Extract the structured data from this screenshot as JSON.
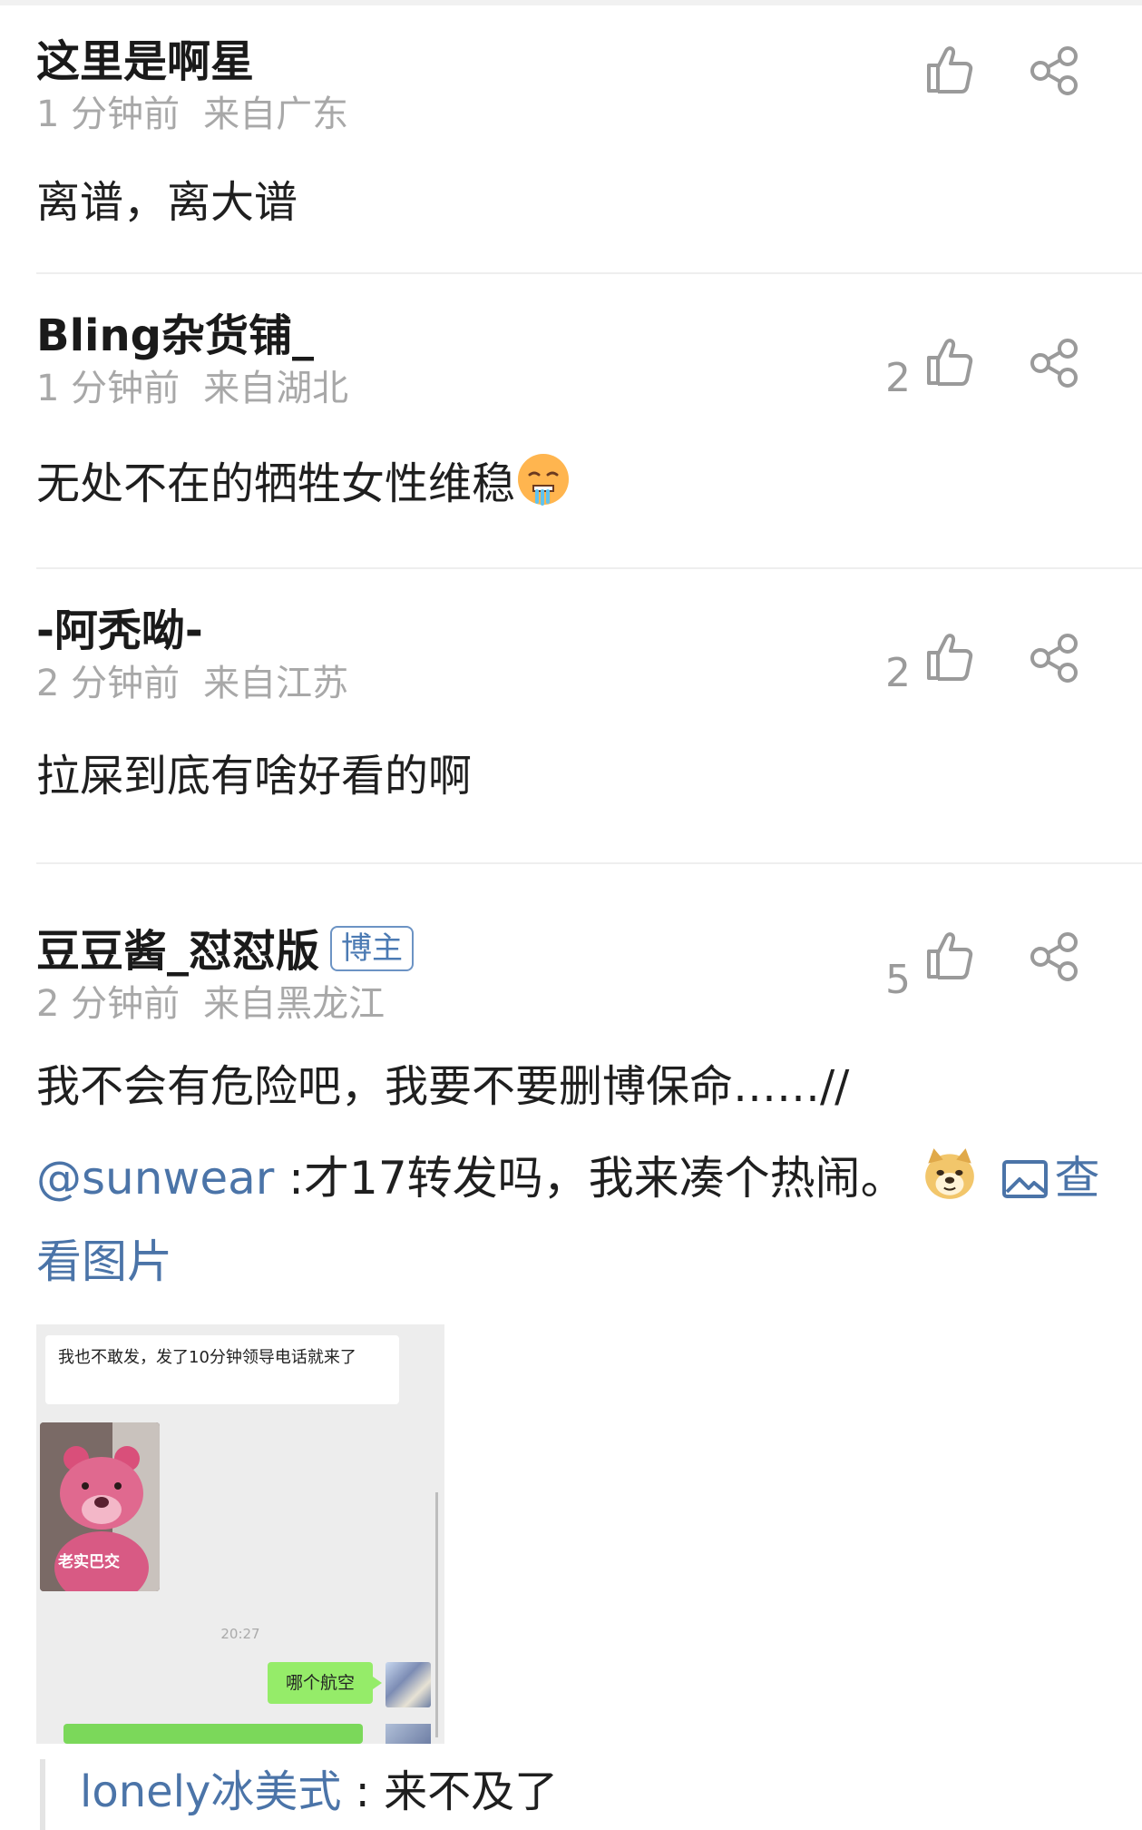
{
  "comments": [
    {
      "username": "这里是啊星",
      "time": "1 分钟前",
      "location": "来自广东",
      "text": "离谱，离大谱",
      "likes": ""
    },
    {
      "username": "Bling杂货铺_",
      "time": "1 分钟前",
      "location": "来自湖北",
      "text": "无处不在的牺牲女性维稳",
      "emoji": "hot-face-emoji",
      "likes": "2"
    },
    {
      "username": "-阿秃呦-",
      "time": "2 分钟前",
      "location": "来自江苏",
      "text": "拉屎到底有啥好看的啊",
      "likes": "2"
    },
    {
      "username": "豆豆酱_怼怼版",
      "badge": "博主",
      "time": "2 分钟前",
      "location": "来自黑龙江",
      "text": "我不会有危险吧，我要不要删博保命……//",
      "likes": "5",
      "repost": {
        "mention": "@sunwear",
        "text": " :才17转发吗，我来凑个热闹。",
        "emoji": "doge-emoji",
        "view_image": "查看图片"
      },
      "image": {
        "bubble_text": "我也不敢发，发了10分钟领导电话就来了",
        "photo_caption": "老实巴交",
        "timestamp": "20:27",
        "reply_bubble": "哪个航空"
      },
      "reply": {
        "name": "lonely冰美式",
        "separator": " : ",
        "text": "来不及了"
      }
    }
  ],
  "colors": {
    "link": "#4b74a8",
    "meta": "#a8a8a8",
    "icon": "#9a9a9a"
  }
}
